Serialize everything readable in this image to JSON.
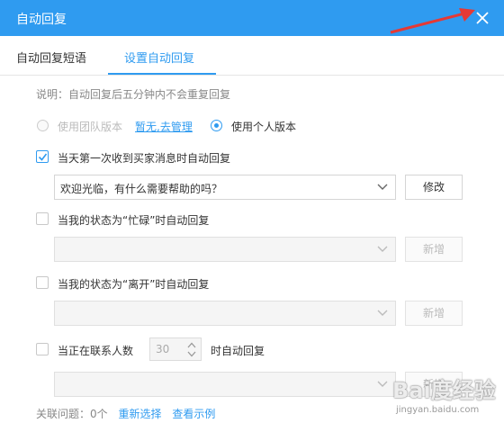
{
  "window": {
    "title": "自动回复"
  },
  "tabs": [
    {
      "label": "自动回复短语"
    },
    {
      "label": "设置自动回复"
    }
  ],
  "note": "说明：自动回复后五分钟内不会重复回复",
  "version": {
    "team_label": "使用团队版本",
    "team_link": "暂无,去管理",
    "personal_label": "使用个人版本",
    "selected": "personal"
  },
  "rules": [
    {
      "checked": true,
      "label": "当天第一次收到买家消息时自动回复",
      "selected_value": "欢迎光临，有什么需要帮助的吗？",
      "button": "修改"
    },
    {
      "checked": false,
      "label": "当我的状态为“忙碌”时自动回复",
      "selected_value": "",
      "button": "新增"
    },
    {
      "checked": false,
      "label": "当我的状态为“离开”时自动回复",
      "selected_value": "",
      "button": "新增"
    },
    {
      "checked": false,
      "label_prefix": "当正在联系人数",
      "stepper_value": "30",
      "label_suffix": "时自动回复",
      "selected_value": "",
      "button": "新增"
    }
  ],
  "footer": {
    "related_label": "关联问题：0个",
    "reselect": "重新选择",
    "view_example": "查看示例"
  },
  "watermark": {
    "brand": "Bai度经验",
    "url": "jingyan.baidu.com"
  },
  "colors": {
    "accent": "#2f9bf0",
    "annotation_arrow": "#e53935"
  }
}
